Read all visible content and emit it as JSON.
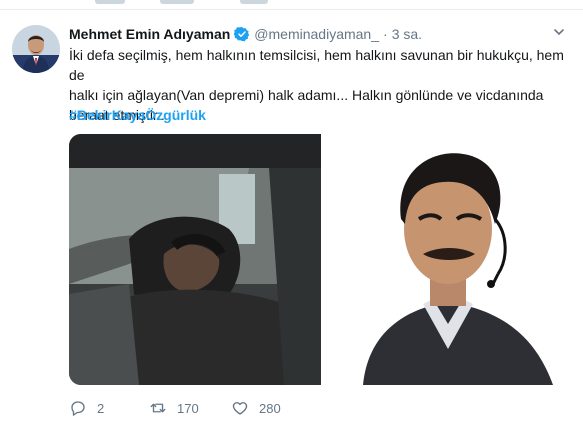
{
  "tweet": {
    "author_name": "Mehmet Emin Adıyaman",
    "handle": "@meminadiyaman_",
    "separator": "·",
    "time": "3 sa.",
    "text": "İki defa seçilmiş, hem halkının temsilcisi, hem halkını savunan bir hukukçu, hem de\nhalkı için ağlayan(Van depremi) halk adamı... Halkın gönlünde ve vicdanında\nberaat etmiştir..",
    "hashtag": "#BekirKayaÖzgürlük",
    "media": [
      {
        "icon": "photo-man-crying-in-car"
      },
      {
        "icon": "photo-man-with-headset-mic"
      }
    ],
    "actions": {
      "reply_count": "2",
      "retweet_count": "170",
      "like_count": "280"
    }
  },
  "colors": {
    "link": "#1da1f2",
    "secondary_text": "#657786",
    "verified": "#1da1f2"
  }
}
